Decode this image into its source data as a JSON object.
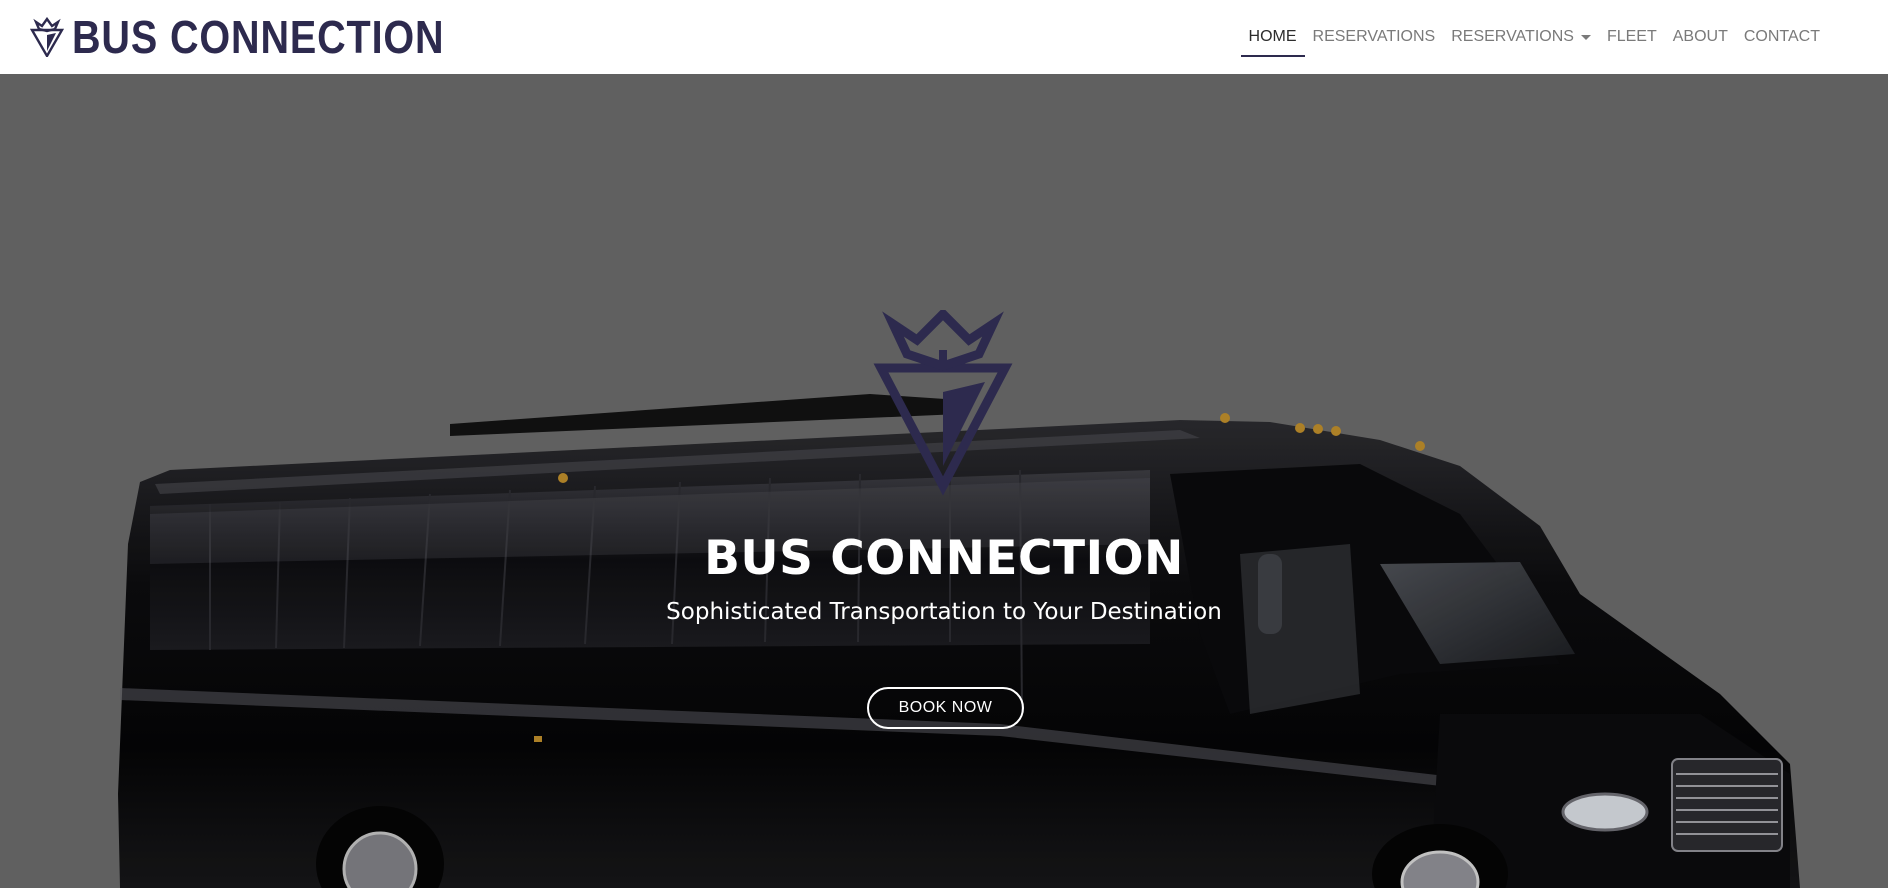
{
  "brand": {
    "name": "BUS CONNECTION",
    "logo_icon": "crown-v-emblem-icon",
    "color": "#2d2a4e"
  },
  "nav": {
    "items": [
      {
        "label": "HOME",
        "active": true
      },
      {
        "label": "RESERVATIONS",
        "active": false
      },
      {
        "label": "RESERVATIONS",
        "active": false,
        "dropdown": true
      },
      {
        "label": "FLEET",
        "active": false
      },
      {
        "label": "ABOUT",
        "active": false
      },
      {
        "label": "CONTACT",
        "active": false
      }
    ]
  },
  "hero": {
    "title": "BUS CONNECTION",
    "subtitle": "Sophisticated Transportation to Your Destination",
    "cta_label": "BOOK NOW",
    "overlay_color": "#666666",
    "emblem_color": "#2d2a4e",
    "image": "black-party-bus-photo"
  }
}
